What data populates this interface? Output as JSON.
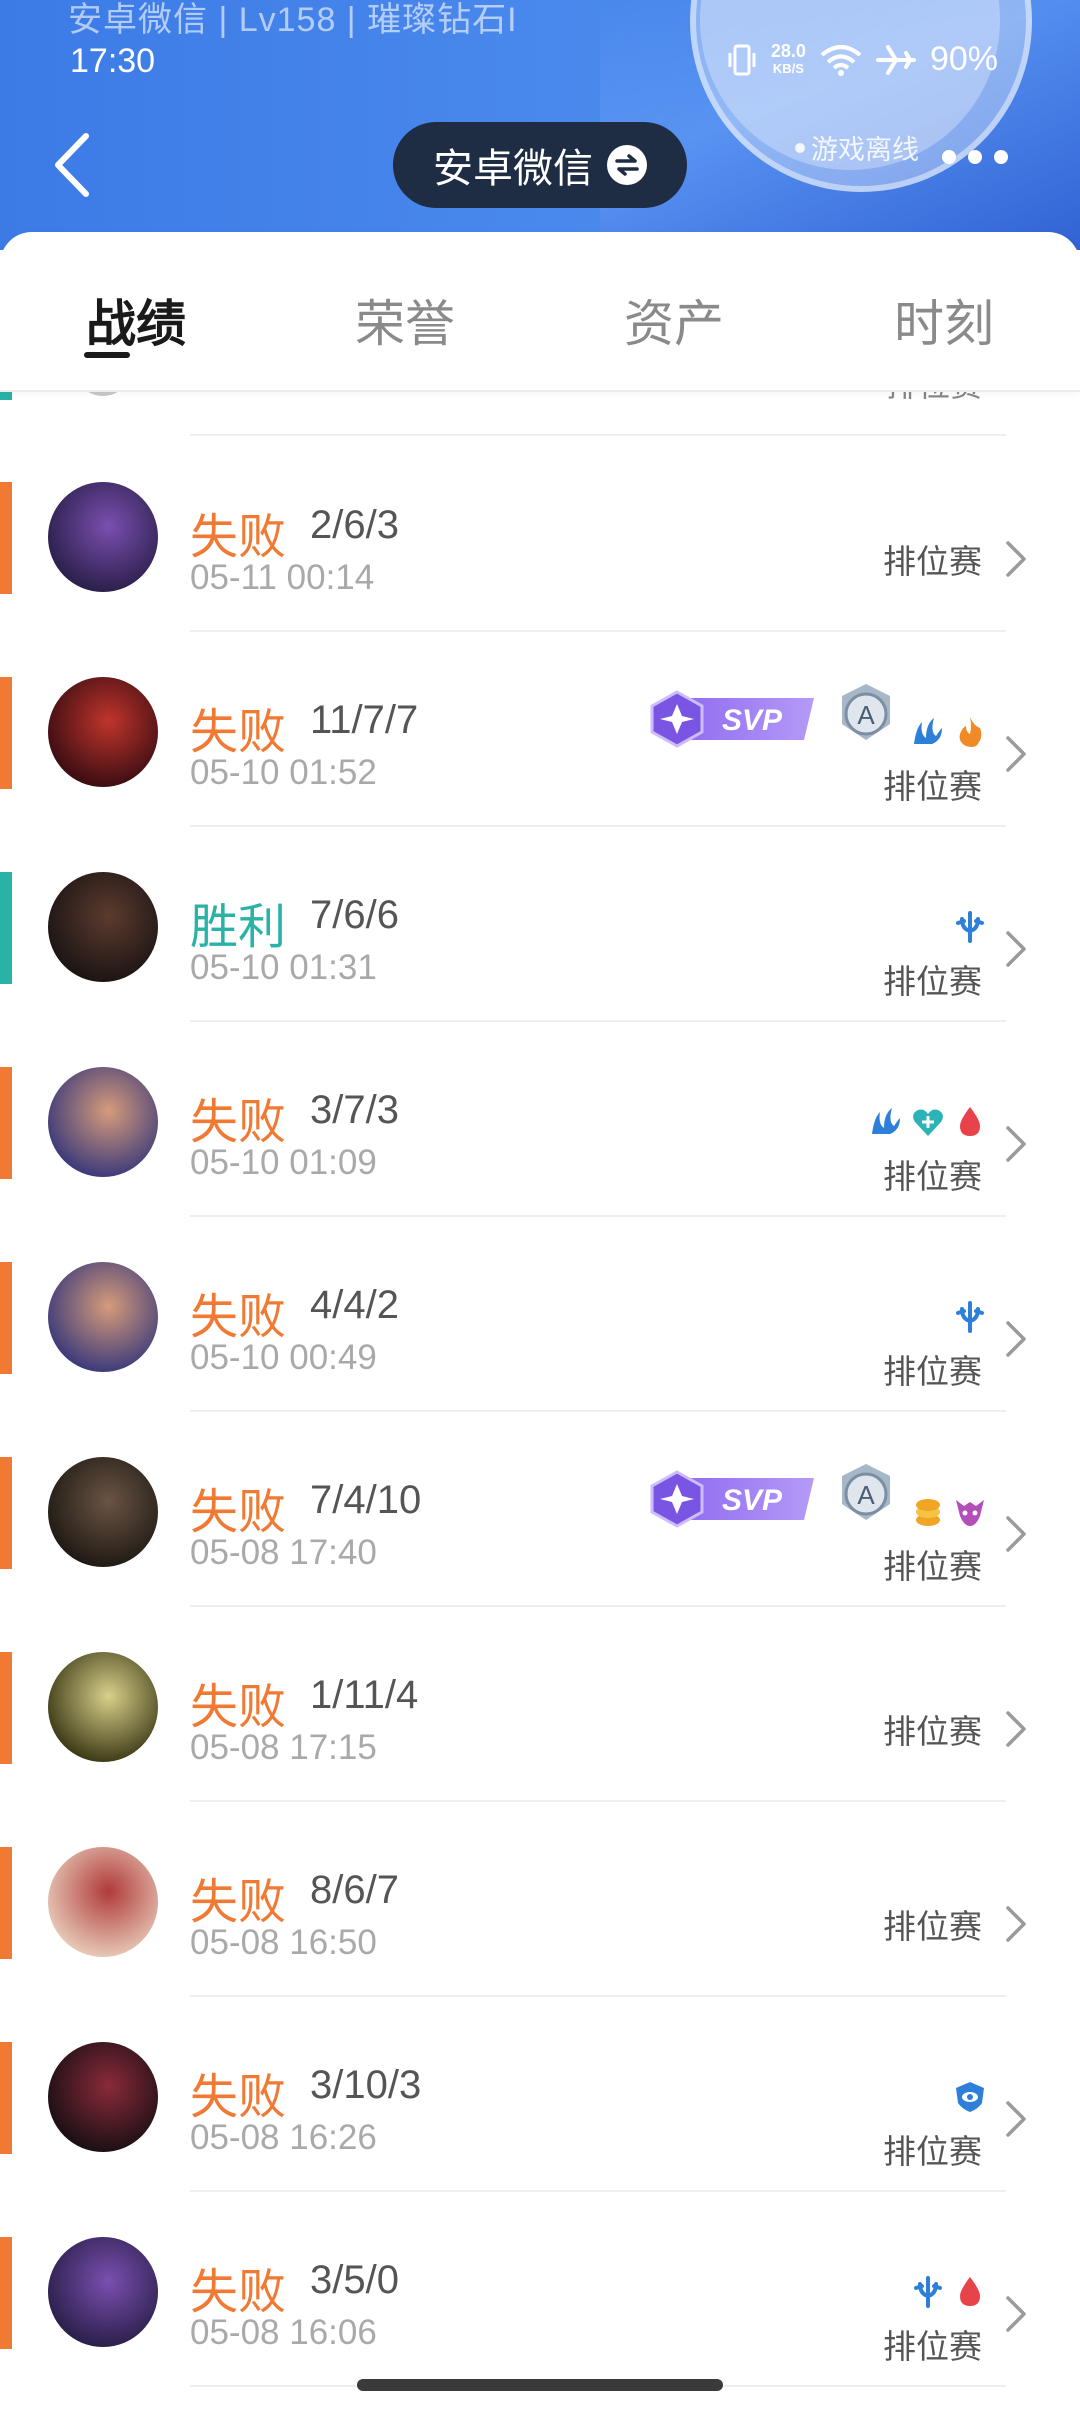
{
  "header": {
    "subtitle": "安卓微信 | Lv158 | 璀璨钻石I",
    "status_time": "17:30",
    "network_speed_value": "28.0",
    "network_speed_unit": "KB/S",
    "battery": "90%",
    "title": "安卓微信",
    "offline_text": "游戏离线",
    "accent": "#3c7be6"
  },
  "tabs": [
    {
      "label": "战绩"
    },
    {
      "label": "荣誉"
    },
    {
      "label": "资产"
    },
    {
      "label": "时刻"
    }
  ],
  "partial_row": {
    "mode": "排位赛"
  },
  "matches": [
    {
      "result": "失败",
      "outcome": "loss",
      "kda": "2/6/3",
      "time": "05-11 00:14",
      "mode": "排位赛",
      "svp": false,
      "avatar": [
        "#2a1f4a",
        "#7a4fb0"
      ],
      "icons": []
    },
    {
      "result": "失败",
      "outcome": "loss",
      "kda": "11/7/7",
      "time": "05-10 01:52",
      "mode": "排位赛",
      "svp": true,
      "avatar": [
        "#3a0d12",
        "#c0342c"
      ],
      "icons": [
        "hydra-icon",
        "fire-icon"
      ]
    },
    {
      "result": "胜利",
      "outcome": "win",
      "kda": "7/6/6",
      "time": "05-10 01:31",
      "mode": "排位赛",
      "svp": false,
      "avatar": [
        "#1b1414",
        "#5c3b2e"
      ],
      "icons": [
        "trident-icon"
      ]
    },
    {
      "result": "失败",
      "outcome": "loss",
      "kda": "3/7/3",
      "time": "05-10 01:09",
      "mode": "排位赛",
      "svp": false,
      "avatar": [
        "#3b3a7a",
        "#d69b7a"
      ],
      "icons": [
        "hydra-icon",
        "heart-plus-icon",
        "blood-drop-icon"
      ]
    },
    {
      "result": "失败",
      "outcome": "loss",
      "kda": "4/4/2",
      "time": "05-10 00:49",
      "mode": "排位赛",
      "svp": false,
      "avatar": [
        "#3b3a7a",
        "#d69b7a"
      ],
      "icons": [
        "trident-icon"
      ]
    },
    {
      "result": "失败",
      "outcome": "loss",
      "kda": "7/4/10",
      "time": "05-08 17:40",
      "mode": "排位赛",
      "svp": true,
      "avatar": [
        "#1f1a14",
        "#6a5444"
      ],
      "icons": [
        "coins-icon",
        "demon-icon"
      ]
    },
    {
      "result": "失败",
      "outcome": "loss",
      "kda": "1/11/4",
      "time": "05-08 17:15",
      "mode": "排位赛",
      "svp": false,
      "avatar": [
        "#3c3a16",
        "#d8d08a"
      ],
      "icons": []
    },
    {
      "result": "失败",
      "outcome": "loss",
      "kda": "8/6/7",
      "time": "05-08 16:50",
      "mode": "排位赛",
      "svp": false,
      "avatar": [
        "#e7c9b8",
        "#b03a3a"
      ],
      "icons": []
    },
    {
      "result": "失败",
      "outcome": "loss",
      "kda": "3/10/3",
      "time": "05-08 16:26",
      "mode": "排位赛",
      "svp": false,
      "avatar": [
        "#1a0f14",
        "#8a2a3a"
      ],
      "icons": [
        "shield-eye-icon"
      ]
    },
    {
      "result": "失败",
      "outcome": "loss",
      "kda": "3/5/0",
      "time": "05-08 16:06",
      "mode": "排位赛",
      "svp": false,
      "avatar": [
        "#2a1f4a",
        "#7a4fb0"
      ],
      "icons": [
        "trident-icon",
        "blood-drop-icon"
      ]
    }
  ],
  "badges": {
    "svp_label": "SVP",
    "a_label": "A"
  }
}
